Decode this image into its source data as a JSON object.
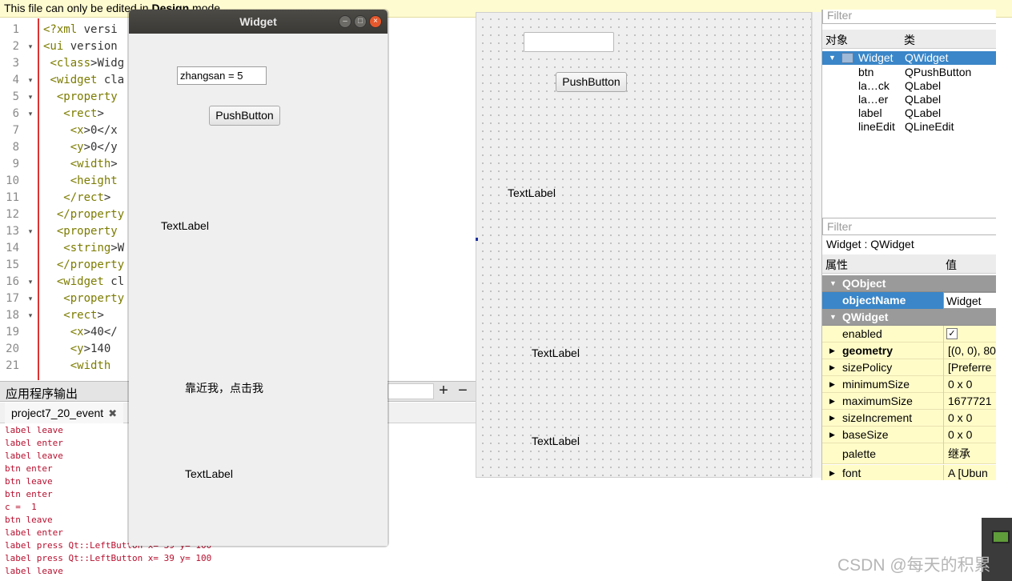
{
  "banner": {
    "prefix": "This file can only be edited in ",
    "mode": "Design",
    "suffix": " mode."
  },
  "editor": {
    "line_numbers": [
      "1",
      "2",
      "3",
      "4",
      "5",
      "6",
      "7",
      "8",
      "9",
      "10",
      "11",
      "12",
      "13",
      "14",
      "15",
      "16",
      "17",
      "18",
      "19",
      "20",
      "21"
    ],
    "fold_markers": [
      "",
      "▾",
      "",
      "▾",
      "▾",
      "▾",
      "",
      "",
      "",
      "",
      "",
      "",
      "▾",
      "",
      "",
      "▾",
      "▾",
      "▾",
      "",
      "",
      ""
    ],
    "lines": [
      "<?xml versi",
      "<ui version",
      " <class>Widg",
      " <widget cla",
      "  <property",
      "   <rect>",
      "    <x>0</x",
      "    <y>0</y",
      "    <width>",
      "    <height",
      "   </rect>",
      "  </property",
      "  <property",
      "   <string>W",
      "  </property",
      "  <widget cl",
      "   <property",
      "   <rect>",
      "    <x>40</",
      "    <y>140",
      "    <width"
    ]
  },
  "output": {
    "title": "应用程序输出",
    "add": "+",
    "remove": "−",
    "tab": "project7_20_event",
    "tab_close": "✖",
    "log": [
      "label leave",
      "label enter",
      "label leave",
      "btn enter",
      "btn leave",
      "btn enter",
      "c =  1",
      "btn leave",
      "label enter",
      "label press Qt::LeftButton x= 39 y= 100",
      "label press Qt::LeftButton x= 39 y= 100",
      "label leave"
    ]
  },
  "window": {
    "title": "Widget",
    "minimize": "–",
    "maximize": "□",
    "close": "×",
    "lineedit_value": "zhangsan = 5",
    "button": "PushButton",
    "label1": "TextLabel",
    "label2": "靠近我，点击我",
    "label3": "TextLabel"
  },
  "designer": {
    "button": "PushButton",
    "label1": "TextLabel",
    "label2": "TextLabel",
    "label3": "TextLabel"
  },
  "object_inspector": {
    "filter_placeholder": "Filter",
    "col_object": "对象",
    "col_class": "类",
    "rows": [
      {
        "name": "Widget",
        "class": "QWidget"
      },
      {
        "name": "btn",
        "class": "QPushButton"
      },
      {
        "name": "la…ck",
        "class": "QLabel"
      },
      {
        "name": "la…er",
        "class": "QLabel"
      },
      {
        "name": "label",
        "class": "QLabel"
      },
      {
        "name": "lineEdit",
        "class": "QLineEdit"
      }
    ]
  },
  "property_editor": {
    "filter_placeholder": "Filter",
    "class_line": "Widget : QWidget",
    "col_property": "属性",
    "col_value": "值",
    "cat_qobject": "QObject",
    "object_name_label": "objectName",
    "object_name_value": "Widget",
    "cat_qwidget": "QWidget",
    "enabled_label": "enabled",
    "enabled_check": "✓",
    "geometry_label": "geometry",
    "geometry_value": "[(0, 0), 80",
    "size_policy_label": "sizePolicy",
    "size_policy_value": "[Preferre",
    "minimum_size_label": "minimumSize",
    "minimum_size_value": "0 x 0",
    "maximum_size_label": "maximumSize",
    "maximum_size_value": "1677721",
    "size_increment_label": "sizeIncrement",
    "size_increment_value": "0 x 0",
    "base_size_label": "baseSize",
    "base_size_value": "0 x 0",
    "palette_label": "palette",
    "palette_value": "继承",
    "font_label": "font",
    "font_value": "A  [Ubun"
  },
  "watermark": "CSDN @每天的积累"
}
